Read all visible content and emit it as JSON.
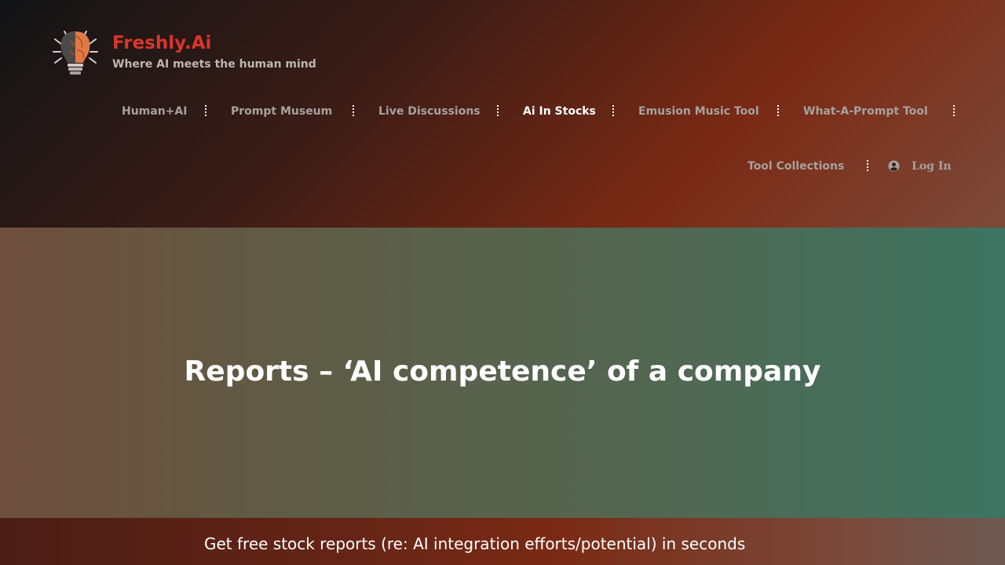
{
  "brand": {
    "title": "Freshly.Ai",
    "tagline": "Where AI meets the human mind",
    "logo_icon": "lightbulb-brain-icon"
  },
  "nav": {
    "items": [
      {
        "label": "Human+AI",
        "active": false
      },
      {
        "label": "Prompt Museum",
        "active": false
      },
      {
        "label": "Live Discussions",
        "active": false
      },
      {
        "label": "Ai In Stocks",
        "active": true
      },
      {
        "label": "Emusion Music Tool",
        "active": false
      },
      {
        "label": "What-A-Prompt Tool",
        "active": false
      },
      {
        "label": "Tool Collections",
        "active": false
      }
    ],
    "login": {
      "label": "Log In",
      "icon": "user-circle-icon"
    }
  },
  "hero": {
    "title": "Reports – ‘AI competence’ of a company"
  },
  "footer_strip": {
    "text": "Get free stock reports (re: AI integration efforts/potential) in seconds"
  },
  "colors": {
    "brand_red": "#d9362b",
    "nav_text": "#a7a19e",
    "nav_active": "#ffffff"
  }
}
